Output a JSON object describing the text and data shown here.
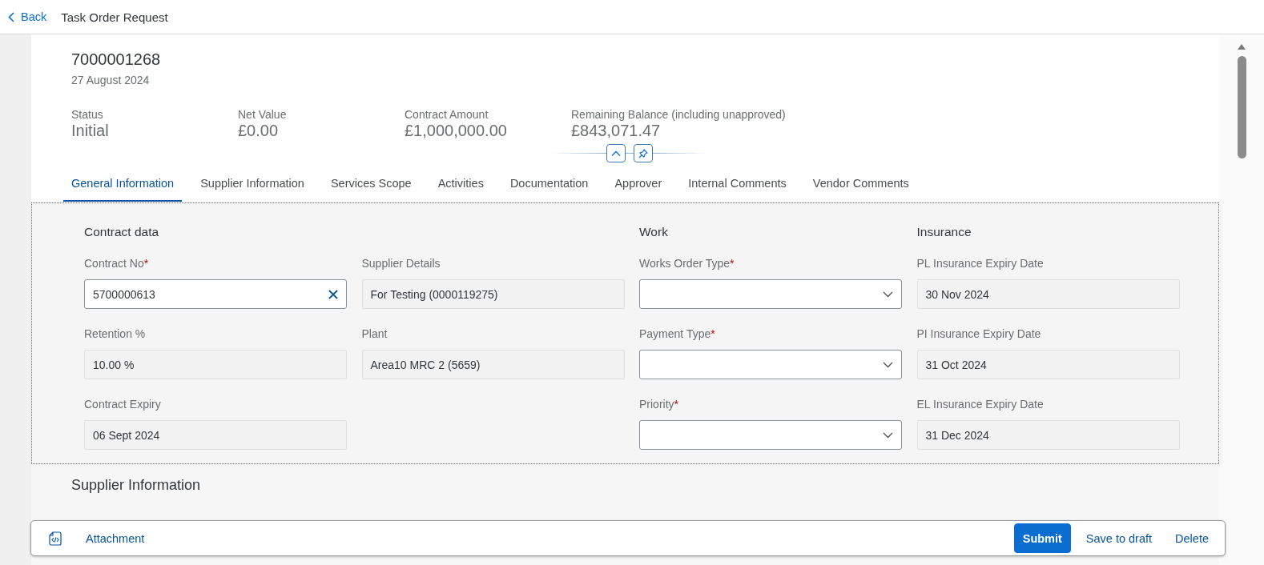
{
  "header": {
    "back_label": "Back",
    "title": "Task Order Request"
  },
  "object": {
    "id": "7000001268",
    "date": "27 August 2024",
    "attributes": [
      {
        "label": "Status",
        "value": "Initial"
      },
      {
        "label": "Net Value",
        "value": "£0.00"
      },
      {
        "label": "Contract Amount",
        "value": "£1,000,000.00"
      },
      {
        "label": "Remaining Balance (including unapproved)",
        "value": "£843,071.47"
      }
    ]
  },
  "tabs": [
    {
      "label": "General Information",
      "selected": true
    },
    {
      "label": "Supplier Information",
      "selected": false
    },
    {
      "label": "Services Scope",
      "selected": false
    },
    {
      "label": "Activities",
      "selected": false
    },
    {
      "label": "Documentation",
      "selected": false
    },
    {
      "label": "Approver",
      "selected": false
    },
    {
      "label": "Internal Comments",
      "selected": false
    },
    {
      "label": "Vendor Comments",
      "selected": false
    }
  ],
  "form": {
    "required_mark": "*",
    "columns": [
      {
        "title": "Contract data",
        "fields": [
          {
            "kind": "input",
            "label": "Contract No",
            "required": true,
            "value": "5700000613"
          },
          {
            "kind": "readonly",
            "label": "Retention %",
            "required": false,
            "value": "10.00  %"
          },
          {
            "kind": "readonly",
            "label": "Contract Expiry",
            "required": false,
            "value": "06 Sept 2024"
          }
        ]
      },
      {
        "fields": [
          {
            "kind": "readonly",
            "label": "Supplier Details",
            "required": false,
            "value": "For Testing (0000119275)"
          },
          {
            "kind": "readonly",
            "label": "Plant",
            "required": false,
            "value": "Area10 MRC 2 (5659)"
          }
        ]
      },
      {
        "title": "Work",
        "fields": [
          {
            "kind": "select",
            "label": "Works Order Type",
            "required": true
          },
          {
            "kind": "select",
            "label": "Payment Type",
            "required": true
          },
          {
            "kind": "select",
            "label": "Priority",
            "required": true
          }
        ]
      },
      {
        "title": "Insurance",
        "fields": [
          {
            "kind": "readonly",
            "label": "PL Insurance Expiry Date",
            "required": false,
            "value": "30 Nov 2024"
          },
          {
            "kind": "readonly",
            "label": "PI Insurance Expiry Date",
            "required": false,
            "value": "31 Oct 2024"
          },
          {
            "kind": "readonly",
            "label": "EL Insurance Expiry Date",
            "required": false,
            "value": "31 Dec 2024"
          }
        ]
      }
    ]
  },
  "next_section": {
    "title": "Supplier Information"
  },
  "footer": {
    "attachment": "Attachment",
    "buttons": [
      {
        "kind": "emphasized",
        "label": "Submit"
      },
      {
        "kind": "transparent",
        "label": "Save to draft"
      },
      {
        "kind": "transparent",
        "label": "Delete"
      }
    ]
  }
}
